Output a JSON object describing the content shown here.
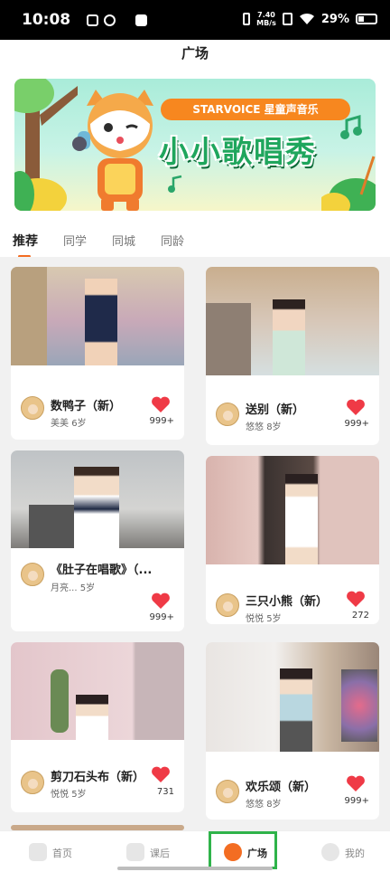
{
  "status_bar": {
    "time": "10:08",
    "speed_value": "7.40",
    "speed_unit": "MB/s",
    "battery": "29%"
  },
  "header": {
    "title": "广场"
  },
  "banner": {
    "brand_text": "STARVOICE 星童声音乐",
    "headline": "小小歌唱秀"
  },
  "tabs": [
    {
      "label": "推荐",
      "active": true
    },
    {
      "label": "同学",
      "active": false
    },
    {
      "label": "同城",
      "active": false
    },
    {
      "label": "同龄",
      "active": false
    }
  ],
  "cards": [
    {
      "title": "数鸭子（新）",
      "author": "美美",
      "age": "6岁",
      "likes": "999+"
    },
    {
      "title": "送别（新）",
      "author": "悠悠",
      "age": "8岁",
      "likes": "999+"
    },
    {
      "title": "《肚子在唱歌》（...",
      "author": "月亮...",
      "age": "5岁",
      "likes": "999+"
    },
    {
      "title": "三只小熊（新）",
      "author": "悦悦",
      "age": "5岁",
      "likes": "272"
    },
    {
      "title": "剪刀石头布（新）",
      "author": "悦悦",
      "age": "5岁",
      "likes": "731"
    },
    {
      "title": "欢乐颂（新）",
      "author": "悠悠",
      "age": "8岁",
      "likes": "999+"
    }
  ],
  "tabbar": [
    {
      "label": "首页",
      "icon": "home-icon"
    },
    {
      "label": "课后",
      "icon": "after-class-icon"
    },
    {
      "label": "广场",
      "icon": "plaza-icon",
      "active": true
    },
    {
      "label": "我的",
      "icon": "profile-icon"
    }
  ],
  "colors": {
    "accent": "#f36d22",
    "heart": "#ef3a46",
    "active_box": "#2fb34a",
    "banner_headline": "#1fa65d"
  }
}
